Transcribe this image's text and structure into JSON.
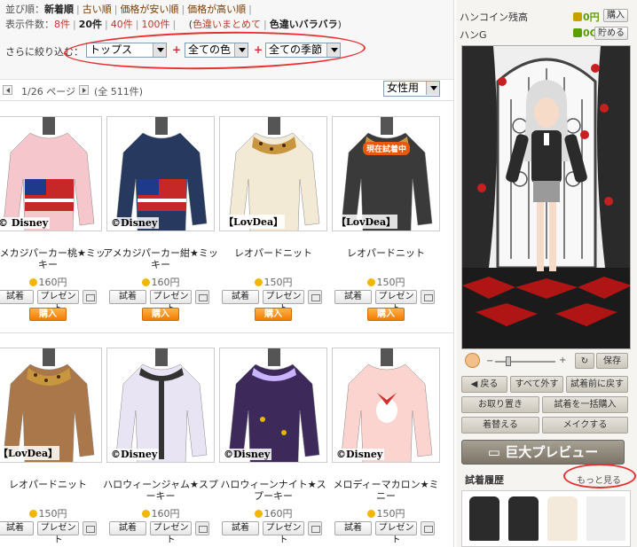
{
  "filters": {
    "sort_label": "並び順：",
    "sort_options": [
      "新着順",
      "古い順",
      "価格が安い順",
      "価格が高い順"
    ],
    "count_label": "表示件数：",
    "count_options": [
      "8件",
      "20件",
      "40件",
      "100件"
    ],
    "color_toggle": [
      "色違いまとめて",
      "色違いバラバラ"
    ],
    "narrow_label": "さらに絞り込む：",
    "category_select": "トップス",
    "color_select": "全ての色",
    "season_select": "全ての季節",
    "plus": "+"
  },
  "pager": {
    "page_text": "1/26 ページ",
    "total_text": "(全 511件)",
    "gender_select": "女性用"
  },
  "items": [
    {
      "name": "アメカジパーカー桃★ミッキー",
      "price": "160円",
      "brand": "© Disney",
      "status": ""
    },
    {
      "name": "アメカジパーカー紺★ミッキー",
      "price": "160円",
      "brand": "©Disney",
      "status": ""
    },
    {
      "name": "レオパードニット",
      "price": "150円",
      "brand": "【LovDea】",
      "status": ""
    },
    {
      "name": "レオパードニット",
      "price": "150円",
      "brand": "【LovDea】",
      "status": "現在試着中"
    },
    {
      "name": "レオパードニット",
      "price": "150円",
      "brand": "【LovDea】",
      "status": ""
    },
    {
      "name": "ハロウィーンジャム★スプーキー",
      "price": "160円",
      "brand": "©Disney",
      "status": ""
    },
    {
      "name": "ハロウィーンナイト★スプーキー",
      "price": "160円",
      "brand": "©Disney",
      "status": ""
    },
    {
      "name": "メロディーマカロン★ミニー",
      "price": "150円",
      "brand": "©Disney",
      "status": ""
    }
  ],
  "item_buttons": {
    "try": "試着",
    "present": "プレゼント",
    "buy": "購入"
  },
  "right_panel": {
    "coin_label": "ハンコイン残高",
    "coin_value": "0円",
    "coin_buy": "購入",
    "hang_label": "ハンG",
    "hang_value": "0G",
    "hang_save": "貯める",
    "save_btn": "保存",
    "actions": [
      "戻る",
      "すべて外す",
      "試着前に戻す",
      "お取り置き",
      "試着を一括購入",
      "着替える",
      "メイクする"
    ],
    "preview_btn": "巨大プレビュー",
    "history_label": "試着履歴",
    "more_link": "もっと見る"
  },
  "colors": {
    "accent": "#f07c00",
    "link": "#7a3a00",
    "annotation": "#e83030"
  }
}
